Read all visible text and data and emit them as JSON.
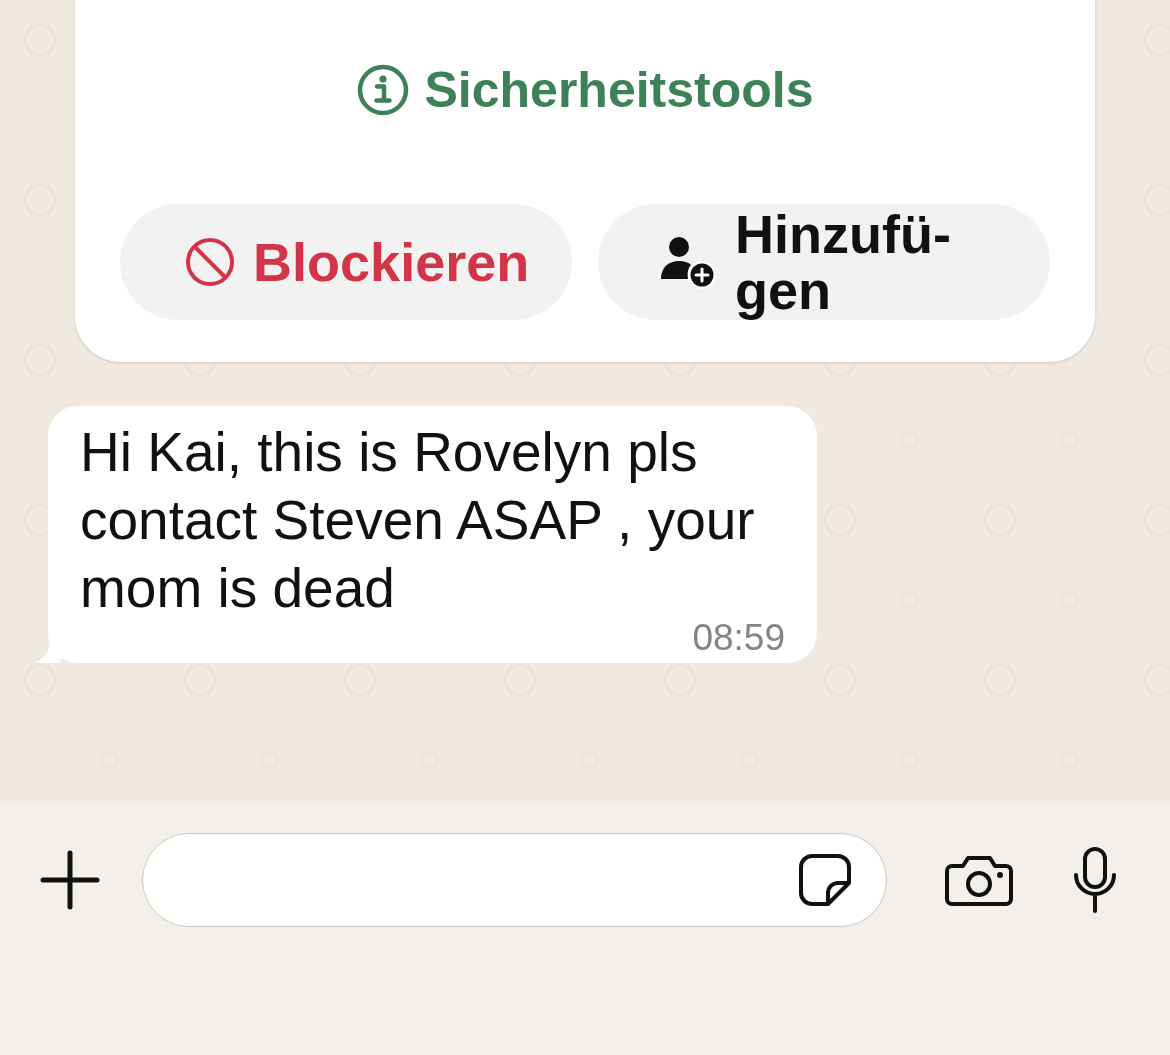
{
  "safety_card": {
    "tools_link": "Sicherheitstools",
    "buttons": [
      {
        "kind": "block",
        "label": "Blockieren"
      },
      {
        "kind": "add",
        "label": "Hinzufü-gen"
      }
    ]
  },
  "messages": [
    {
      "kind": "incoming",
      "text": "Hi Kai, this is Rovelyn pls contact Steven ASAP , your mom is dead",
      "time": "08:59"
    }
  ]
}
